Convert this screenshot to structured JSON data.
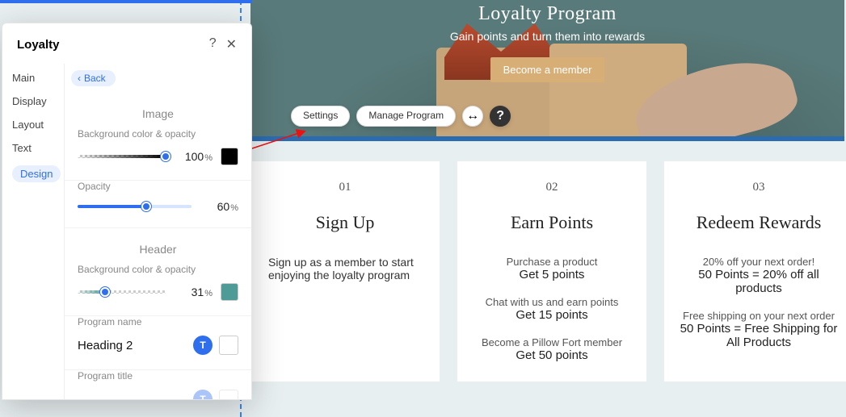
{
  "hero": {
    "title": "Loyalty Program",
    "subtitle": "Gain points and turn them into rewards",
    "cta": "Become a member"
  },
  "pills": {
    "settings": "Settings",
    "manage": "Manage Program",
    "resize_icon": "↔",
    "help_icon": "?"
  },
  "cards": [
    {
      "num": "01",
      "title": "Sign Up",
      "desc": "Sign up as a member to start enjoying the loyalty program"
    },
    {
      "num": "02",
      "title": "Earn Points",
      "items": [
        {
          "line": "Purchase a product",
          "strong": "Get 5 points"
        },
        {
          "line": "Chat with us and earn points",
          "strong": "Get 15 points"
        },
        {
          "line": "Become a Pillow Fort member",
          "strong": "Get 50 points"
        }
      ]
    },
    {
      "num": "03",
      "title": "Redeem Rewards",
      "items": [
        {
          "line": "20% off your next order!",
          "strong": "50 Points = 20% off all products"
        },
        {
          "line": "Free shipping on your next order",
          "strong": "50 Points = Free Shipping for All Products"
        }
      ]
    }
  ],
  "panel": {
    "title": "Loyalty",
    "help_icon": "?",
    "close_icon": "✕",
    "tabs": [
      "Main",
      "Display",
      "Layout",
      "Text",
      "Design"
    ],
    "active_tab": "Design",
    "back": "Back",
    "sections": {
      "image": {
        "heading": "Image",
        "bg_label": "Background color & opacity",
        "bg_value": "100",
        "bg_swatch": "#000000",
        "opacity_label": "Opacity",
        "opacity_value": "60"
      },
      "header": {
        "heading": "Header",
        "bg_label": "Background color & opacity",
        "bg_value": "31",
        "bg_swatch": "#4f9b97",
        "program_name_label": "Program name",
        "program_name_value": "Heading 2",
        "program_title_label": "Program title"
      }
    },
    "percent_unit": "%"
  }
}
